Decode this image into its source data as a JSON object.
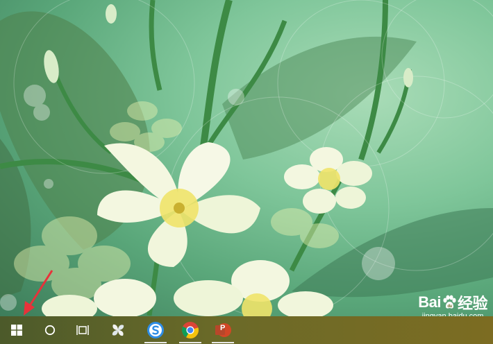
{
  "watermark": {
    "brand_left": "Bai",
    "brand_right": "经验",
    "url": "jingyan.baidu.com"
  },
  "taskbar": {
    "icons": [
      "windows-start-icon",
      "cortana-search-icon",
      "task-view-icon",
      "pinwheel-app-icon",
      "sogou-browser-icon",
      "chrome-icon",
      "powerpoint-icon"
    ],
    "powerpoint_letter": "P"
  },
  "colors": {
    "annotation_arrow": "#e8323a",
    "taskbar_left": "#4c5a2a",
    "taskbar_right": "#7c6c22",
    "powerpoint": "#d24726",
    "sogou": "#2f8de4"
  }
}
